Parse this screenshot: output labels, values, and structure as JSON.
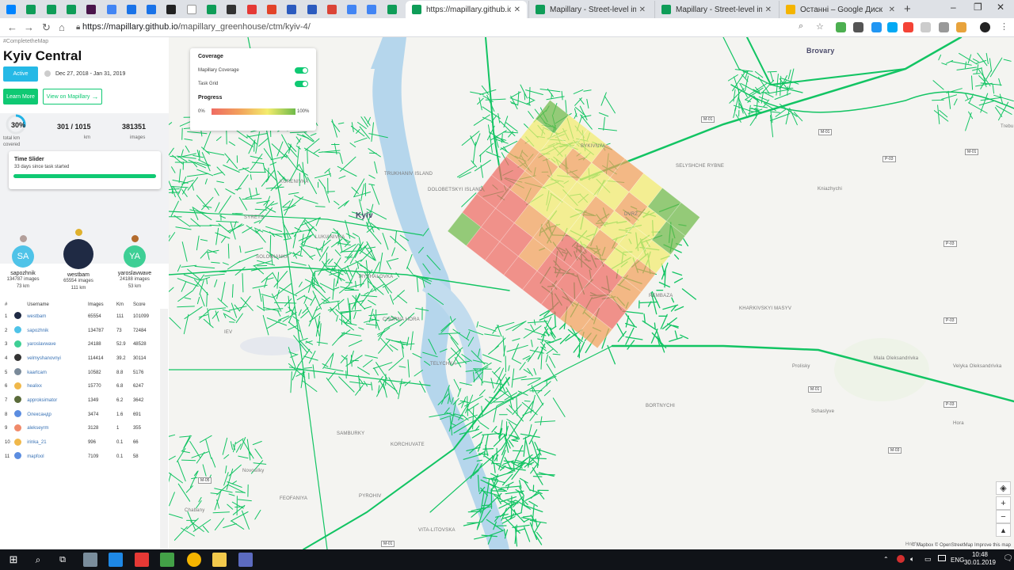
{
  "browser": {
    "pinned_tabs": [
      {
        "icon": "messenger-icon",
        "color": "#0084ff"
      },
      {
        "icon": "sheets-icon",
        "color": "#0f9d58"
      },
      {
        "icon": "sheets-icon",
        "color": "#0f9d58"
      },
      {
        "icon": "sheets-icon",
        "color": "#0f9d58"
      },
      {
        "icon": "slack-icon",
        "color": "#4a154b"
      },
      {
        "icon": "docs-icon",
        "color": "#4285f4"
      },
      {
        "icon": "people-icon",
        "color": "#1a73e8"
      },
      {
        "icon": "calendar-icon",
        "color": "#1a73e8"
      },
      {
        "icon": "book-icon",
        "color": "#222222"
      },
      {
        "icon": "photo-icon",
        "color": "#ffffff"
      },
      {
        "icon": "drive-icon",
        "color": "#0f9d58"
      },
      {
        "icon": "puzzle-icon",
        "color": "#333333"
      },
      {
        "icon": "pdf-icon",
        "color": "#e53935"
      },
      {
        "icon": "gitlab-icon",
        "color": "#e24329"
      },
      {
        "icon": "jira-icon",
        "color": "#2c5bbf"
      },
      {
        "icon": "jira-icon",
        "color": "#2c5bbf"
      },
      {
        "icon": "gmail-icon",
        "color": "#db4437"
      },
      {
        "icon": "docs-icon",
        "color": "#4285f4"
      },
      {
        "icon": "docs-icon",
        "color": "#4285f4"
      },
      {
        "icon": "sheets-icon",
        "color": "#0f9d58"
      }
    ],
    "tabs": [
      {
        "title": "https://mapillary.github.io/map",
        "active": true
      },
      {
        "title": "Mapillary - Street-level imagery",
        "active": false
      },
      {
        "title": "Mapillary - Street-level imagery",
        "active": false
      },
      {
        "title": "Останні – Google Диск",
        "active": false
      }
    ],
    "new_tab": "+",
    "url_host": "https://mapillary.github.io",
    "url_path": "/mapillary_greenhouse/ctm/kyiv-4/"
  },
  "panel": {
    "hashtag": "#CompletetheMap",
    "title": "Kyiv Central",
    "status": "Active",
    "dates": "Dec 27, 2018 - Jan 31, 2019",
    "learn_more": "Learn More",
    "view_on": "View on Mapillary",
    "stats": {
      "percent": "30%",
      "percent_label": "total km covered",
      "progress_fraction": 0.3,
      "km": "301 / 1015",
      "km_label": "km",
      "images": "381351",
      "images_label": "images"
    },
    "time_slider": {
      "title": "Time Slider",
      "subtitle": "33 days since task started",
      "fraction": 1.0
    },
    "leaders": [
      {
        "initials": "SA",
        "name": "sapozhnik",
        "images": "134787 images",
        "km": "73 km",
        "color": "#4fc3e8",
        "medal": "#b39f9a"
      },
      {
        "initials": "",
        "name": "westbam",
        "images": "65554 images",
        "km": "111 km",
        "color": "#1f2a44",
        "medal": "#e0b12c"
      },
      {
        "initials": "YA",
        "name": "yaroslavwave",
        "images": "24188 images",
        "km": "53 km",
        "color": "#3ecf95",
        "medal": "#b36b2d"
      }
    ],
    "table": {
      "headers": [
        "#",
        "",
        "Username",
        "Images",
        "Km",
        "Score"
      ],
      "rows": [
        {
          "rank": "1",
          "user": "westbam",
          "images": "65554",
          "km": "111",
          "score": "101099",
          "color": "#1f2a44"
        },
        {
          "rank": "2",
          "user": "sapozhnik",
          "images": "134787",
          "km": "73",
          "score": "72484",
          "color": "#4fc3e8"
        },
        {
          "rank": "3",
          "user": "yaroslavwave",
          "images": "24188",
          "km": "52.9",
          "score": "48528",
          "color": "#3ecf95"
        },
        {
          "rank": "4",
          "user": "velmyshanovnyi",
          "images": "114414",
          "km": "39.2",
          "score": "30114",
          "color": "#333333"
        },
        {
          "rank": "5",
          "user": "kaartcam",
          "images": "10582",
          "km": "8.8",
          "score": "5176",
          "color": "#7a8a99"
        },
        {
          "rank": "6",
          "user": "healixx",
          "images": "15770",
          "km": "6.8",
          "score": "6247",
          "color": "#f0b84a"
        },
        {
          "rank": "7",
          "user": "approksimator",
          "images": "1349",
          "km": "6.2",
          "score": "3642",
          "color": "#5a6b3a"
        },
        {
          "rank": "8",
          "user": "Олександр",
          "images": "3474",
          "km": "1.6",
          "score": "691",
          "color": "#5b8de0"
        },
        {
          "rank": "9",
          "user": "alekseyrm",
          "images": "3128",
          "km": "1",
          "score": "355",
          "color": "#f08a6a"
        },
        {
          "rank": "10",
          "user": "irinka_21",
          "images": "996",
          "km": "0.1",
          "score": "66",
          "color": "#f0b84a"
        },
        {
          "rank": "11",
          "user": "mapfool",
          "images": "7109",
          "km": "0.1",
          "score": "58",
          "color": "#5b8de0"
        }
      ]
    }
  },
  "map": {
    "legend": {
      "coverage": "Coverage",
      "mapillary_coverage": "Mapillary Coverage",
      "task_grid": "Task Grid",
      "progress": "Progress",
      "min": "0%",
      "max": "100%"
    },
    "labels": [
      {
        "text": "Kyiv",
        "cls": "city"
      },
      {
        "text": "Brovary",
        "cls": "city"
      },
      {
        "text": "TRUKHANIV ISLAND"
      },
      {
        "text": "DOLOBETSKYI ISLAND"
      },
      {
        "text": "BYKIVNYA"
      },
      {
        "text": "SELYSHCHE RYBNE"
      },
      {
        "text": "DVRZ"
      },
      {
        "text": "Kniazhychi"
      },
      {
        "text": "REMBAZA"
      },
      {
        "text": "KHARKIVSKYI MASYV"
      },
      {
        "text": "CHORNA HORA"
      },
      {
        "text": "TELYCHKA"
      },
      {
        "text": "BORTNYCHI"
      },
      {
        "text": "Prolisky"
      },
      {
        "text": "Schaslyve"
      },
      {
        "text": "Mala Oleksandrivka"
      },
      {
        "text": "Velyka Oleksandrivka"
      },
      {
        "text": "Hora"
      },
      {
        "text": "KORCHUVATE"
      },
      {
        "text": "SAMBURKY"
      },
      {
        "text": "Novosilky"
      },
      {
        "text": "FEOFANIYA"
      },
      {
        "text": "Chabany"
      },
      {
        "text": "PYROHIV"
      },
      {
        "text": "VITA-LITOVSKA"
      },
      {
        "text": "KURENIVKA"
      },
      {
        "text": "SYRETS"
      },
      {
        "text": "SOLOMIANKA"
      },
      {
        "text": "LUKIANIVKA"
      },
      {
        "text": "MYSHALOVKA"
      },
      {
        "text": "IEV"
      },
      {
        "text": "Hnidyn"
      },
      {
        "text": "Trebu"
      }
    ],
    "shields": [
      "M-01",
      "M-01",
      "P-03",
      "M-01",
      "P-03",
      "P-03",
      "M-01",
      "M-03",
      "M-05",
      "M-01",
      "P-03"
    ],
    "controls": [
      "layers-icon",
      "zoom-in",
      "zoom-out",
      "compass"
    ],
    "attribution": "© Mapbox © OpenStreetMap  Improve this map"
  },
  "taskbar": {
    "lang": "ENG",
    "time": "10:48",
    "date": "30.01.2019",
    "notification_count": "11"
  }
}
